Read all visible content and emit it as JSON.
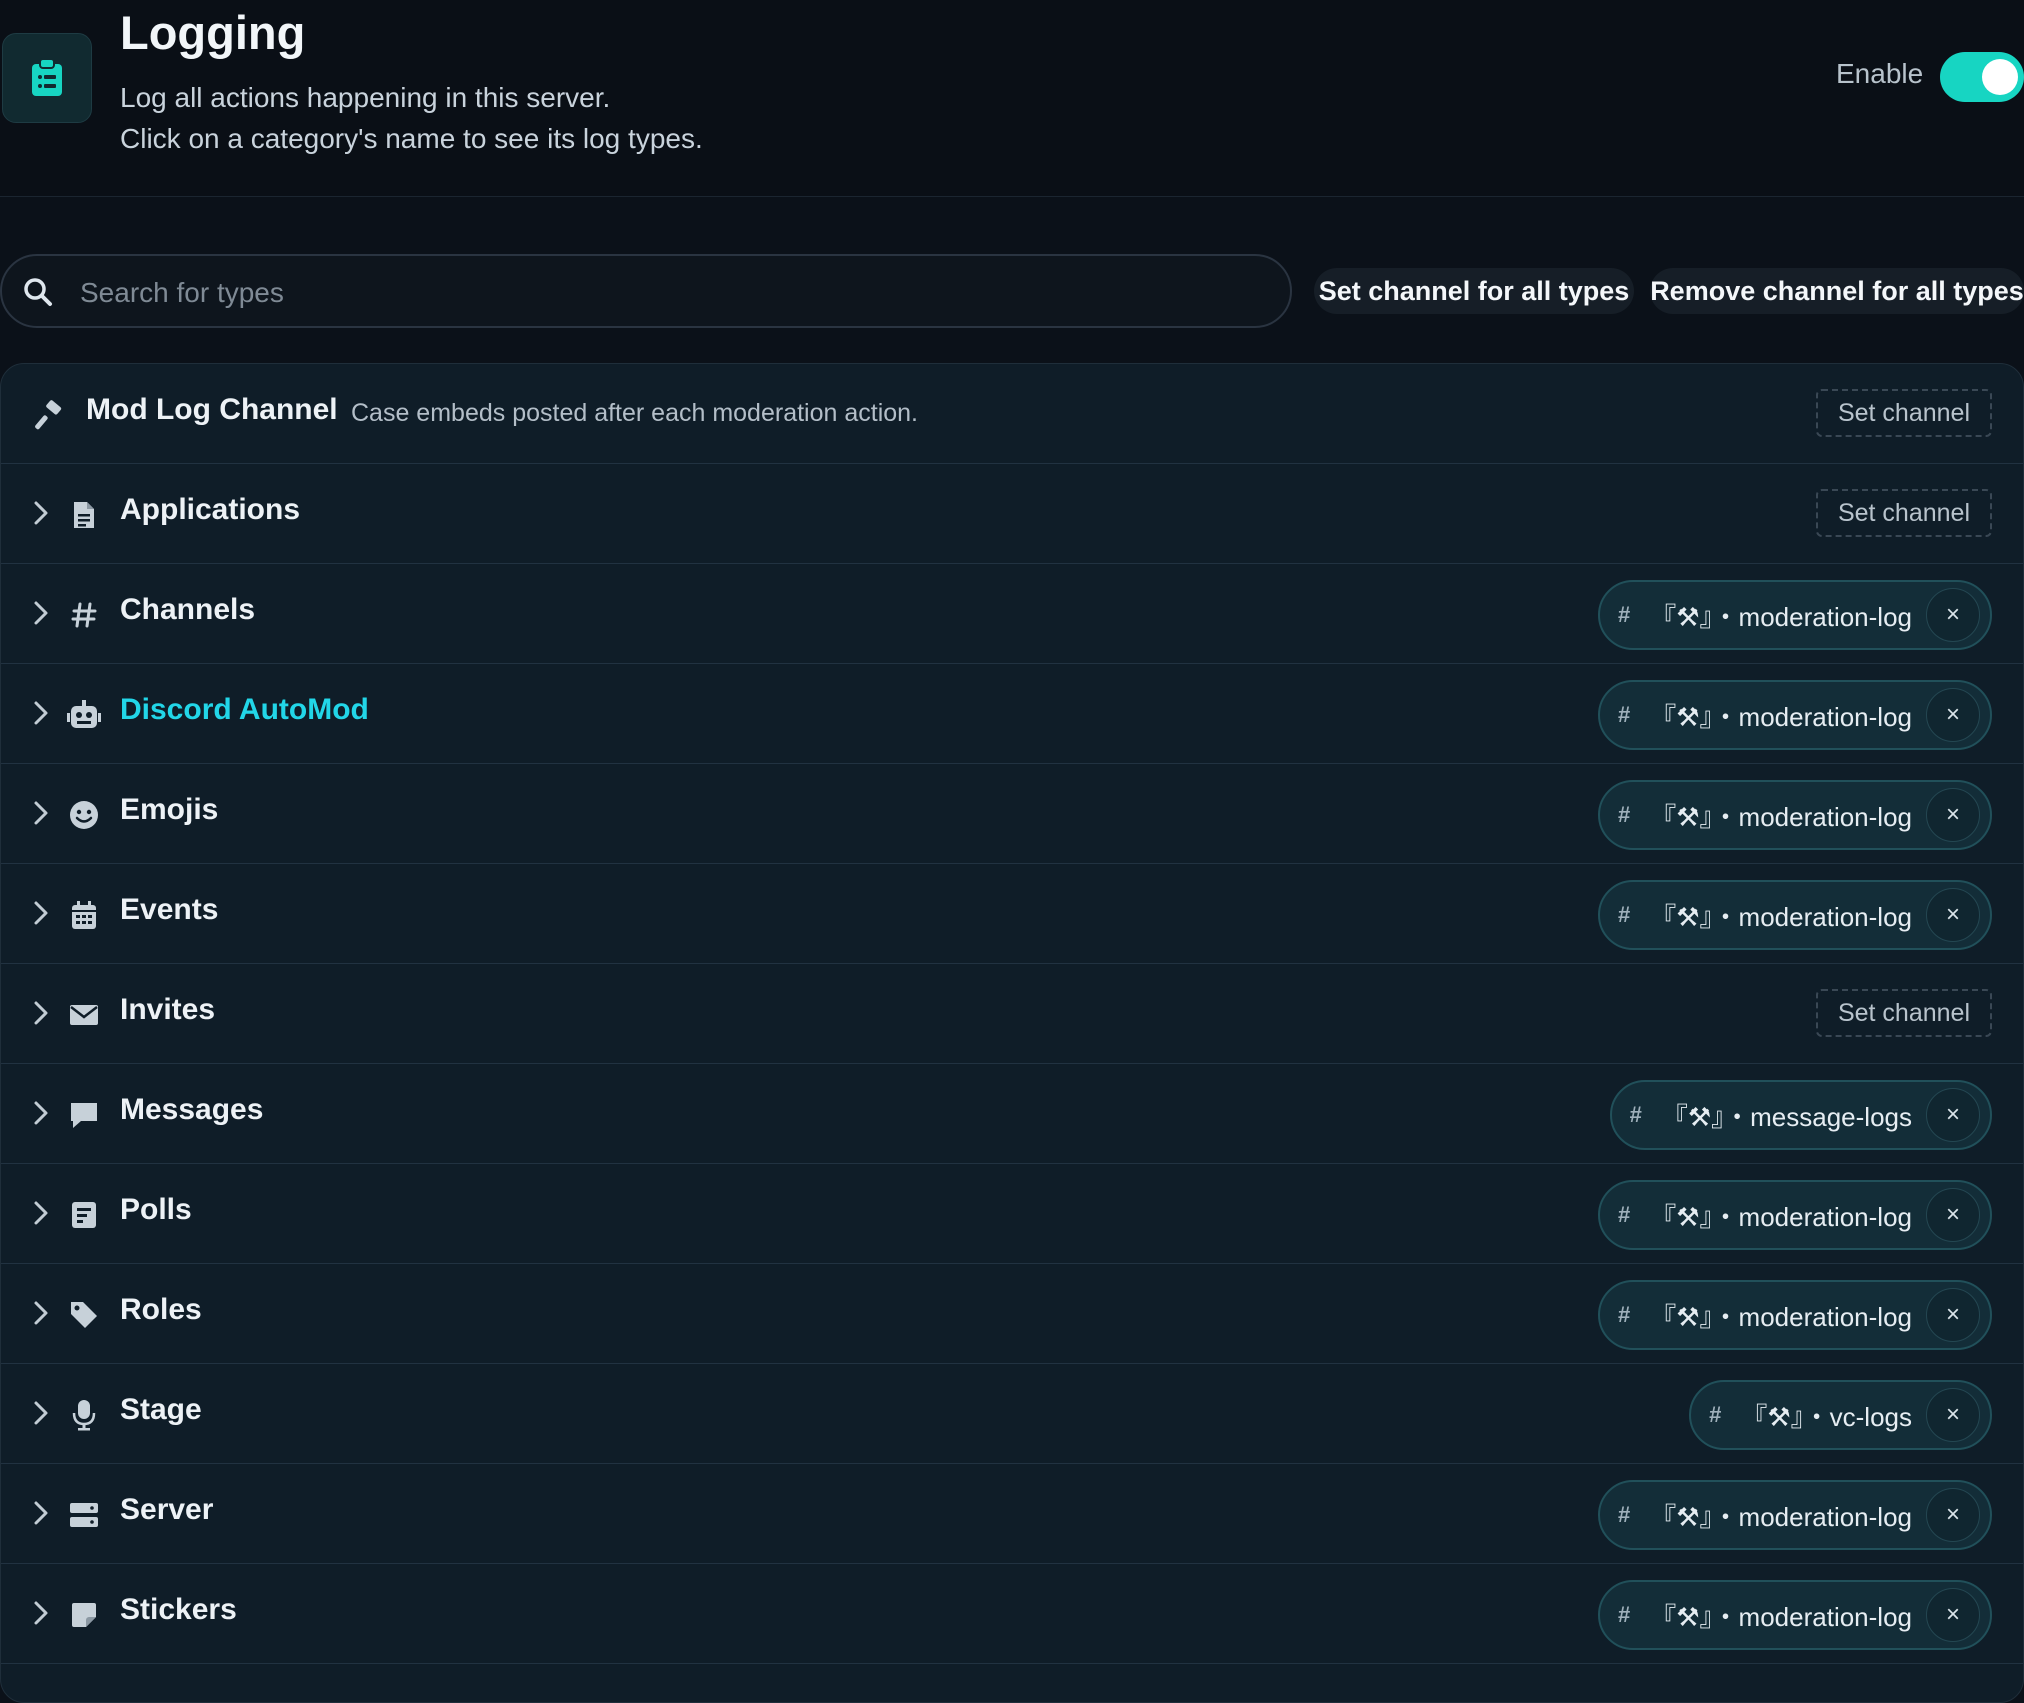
{
  "header": {
    "title": "Logging",
    "description_line1": "Log all actions happening in this server.",
    "description_line2": "Click on a category's name to see its log types.",
    "enable_label": "Enable",
    "enabled": true
  },
  "search": {
    "placeholder": "Search for types",
    "value": ""
  },
  "actions": {
    "set_all": "Set channel for all types",
    "remove_all": "Remove channel for all types"
  },
  "mod_log": {
    "label": "Mod Log Channel",
    "description": "Case embeds posted after each moderation action.",
    "button": "Set channel"
  },
  "categories": [
    {
      "label": "Applications",
      "icon": "document-icon",
      "channel": null,
      "button": "Set channel"
    },
    {
      "label": "Channels",
      "icon": "hash-icon",
      "channel": "『⚒』・moderation-log"
    },
    {
      "label": "Discord AutoMod",
      "icon": "robot-icon",
      "channel": "『⚒』・moderation-log",
      "active": true
    },
    {
      "label": "Emojis",
      "icon": "smile-icon",
      "channel": "『⚒』・moderation-log"
    },
    {
      "label": "Events",
      "icon": "calendar-icon",
      "channel": "『⚒』・moderation-log"
    },
    {
      "label": "Invites",
      "icon": "envelope-icon",
      "channel": null,
      "button": "Set channel"
    },
    {
      "label": "Messages",
      "icon": "chat-icon",
      "channel": "『⚒』・message-logs"
    },
    {
      "label": "Polls",
      "icon": "poll-icon",
      "channel": "『⚒』・moderation-log"
    },
    {
      "label": "Roles",
      "icon": "tag-icon",
      "channel": "『⚒』・moderation-log"
    },
    {
      "label": "Stage",
      "icon": "microphone-icon",
      "channel": "『⚒』・vc-logs"
    },
    {
      "label": "Server",
      "icon": "server-icon",
      "channel": "『⚒』・moderation-log"
    },
    {
      "label": "Stickers",
      "icon": "sticker-icon",
      "channel": "『⚒』・moderation-log"
    }
  ],
  "chip": {
    "hash": "#",
    "remove": "×"
  },
  "colors": {
    "accent": "#17d5c2",
    "active_label": "#22d6e8",
    "background": "#0b1119",
    "panel": "#0f1d28"
  }
}
